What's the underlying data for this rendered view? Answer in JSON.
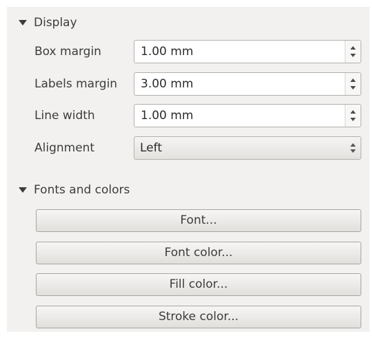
{
  "display": {
    "header": "Display",
    "box_margin": {
      "label": "Box margin",
      "value": "1.00 mm"
    },
    "labels_margin": {
      "label": "Labels margin",
      "value": "3.00 mm"
    },
    "line_width": {
      "label": "Line width",
      "value": "1.00 mm"
    },
    "alignment": {
      "label": "Alignment",
      "value": "Left"
    }
  },
  "fonts_colors": {
    "header": "Fonts and colors",
    "font_button": "Font...",
    "font_color_button": "Font color...",
    "fill_color_button": "Fill color...",
    "stroke_color_button": "Stroke color..."
  }
}
